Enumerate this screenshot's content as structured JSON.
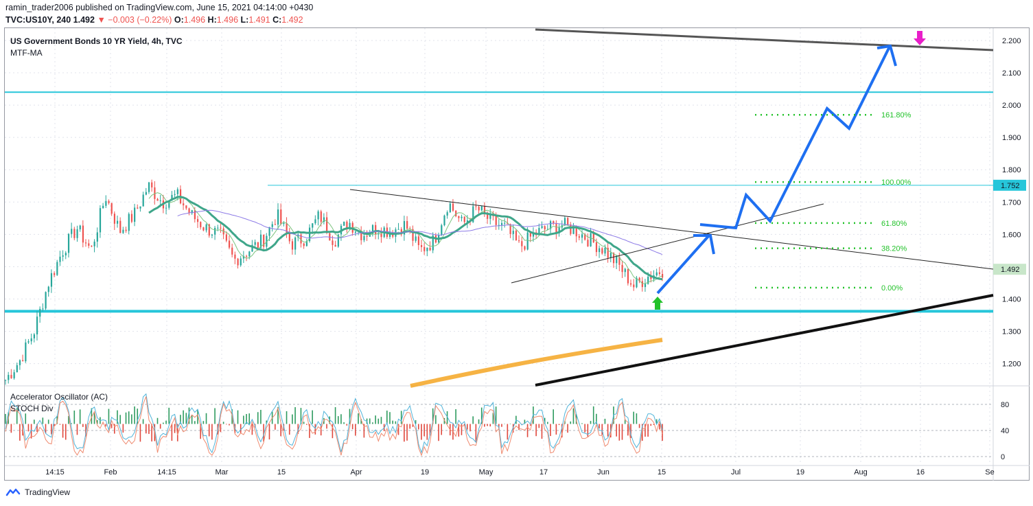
{
  "header": {
    "line1": "ramin_trader2006 published on TradingView.com, June 15, 2021 04:14:00 +0430",
    "symbol": "TVC:US10Y, 240",
    "last": "1.492",
    "change": "▼ −0.003 (−0.22%)",
    "o_label": "O:",
    "o_value": "1.496",
    "h_label": "H:",
    "h_value": "1.496",
    "l_label": "L:",
    "l_value": "1.491",
    "c_label": "C:",
    "c_value": "1.492"
  },
  "chart": {
    "title": "US Government Bonds 10 YR Yield, 4h, TVC",
    "indicator": "MTF-MA"
  },
  "oscillator": {
    "label1": "Accelerator Oscillator (AC)",
    "label2": "STOCH Div",
    "levels": [
      "80",
      "40",
      "0"
    ]
  },
  "footer": {
    "brand": "TradingView"
  },
  "colors": {
    "bull": "#26a69a",
    "bear": "#ef5350",
    "fib": "#22c22a",
    "plan": "#1e6ff1",
    "support": "#26c6da",
    "ma_long": "#f5a623",
    "ma_mid": "#8c7ae6",
    "arrow_up": "#22c22a",
    "arrow_down": "#e91ec9"
  },
  "chart_data": {
    "type": "candlestick",
    "instrument": "US Government Bonds 10 YR Yield",
    "ylim": [
      1.15,
      2.27
    ],
    "y_ticks": [
      "2.200",
      "2.100",
      "2.000",
      "1.900",
      "1.800",
      "1.700",
      "1.600",
      "1.500",
      "1.400",
      "1.300",
      "1.200"
    ],
    "x_ticks": [
      "14:15",
      "Feb",
      "14:15",
      "Mar",
      "15",
      "Apr",
      "19",
      "May",
      "17",
      "Jun",
      "15",
      "Jul",
      "19",
      "Aug",
      "16",
      "Se"
    ],
    "last_price": 1.492,
    "marked_level": 1.752,
    "horizontal_lines": [
      2.04,
      1.752,
      1.362
    ],
    "fibonacci": [
      {
        "label": "161.80%",
        "value": 1.97
      },
      {
        "label": "100.00%",
        "value": 1.762
      },
      {
        "label": "61.80%",
        "value": 1.635
      },
      {
        "label": "38.20%",
        "value": 1.557
      },
      {
        "label": "0.00%",
        "value": 1.435
      }
    ],
    "projected_path": [
      1.438,
      1.635,
      1.665,
      1.66,
      1.765,
      1.67,
      2.03,
      1.965,
      2.21
    ],
    "price_path": [
      1.15,
      1.21,
      1.3,
      1.45,
      1.55,
      1.62,
      1.55,
      1.72,
      1.61,
      1.66,
      1.75,
      1.7,
      1.72,
      1.66,
      1.62,
      1.6,
      1.52,
      1.55,
      1.58,
      1.66,
      1.57,
      1.59,
      1.66,
      1.58,
      1.64,
      1.6,
      1.62,
      1.61,
      1.63,
      1.55,
      1.58,
      1.7,
      1.63,
      1.68,
      1.64,
      1.62,
      1.56,
      1.6,
      1.62,
      1.63,
      1.61,
      1.58,
      1.55,
      1.5,
      1.44,
      1.47,
      1.49
    ],
    "oscillator_range": [
      0,
      100
    ]
  }
}
